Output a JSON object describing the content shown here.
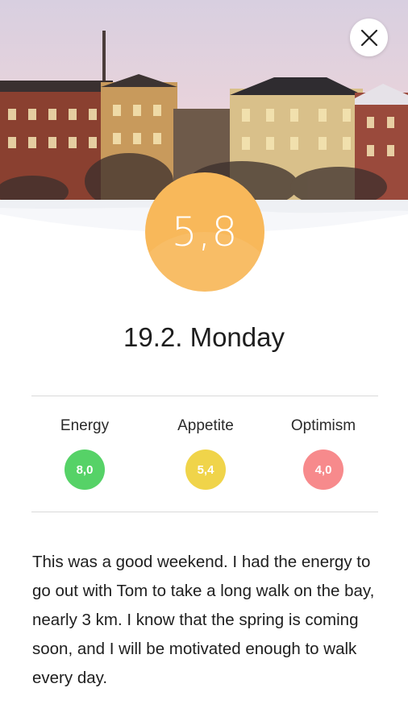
{
  "header": {
    "close_icon": "close-icon",
    "photo": "winter-townhouses-photo"
  },
  "score": {
    "value": "5,8",
    "color": "#F8B85A"
  },
  "entry": {
    "date_title": "19.2. Monday",
    "note": "This was a good weekend. I had the energy to go out with Tom to take a long walk on the bay, nearly 3 km. I know that the spring is coming soon, and I will be motivated enough to walk every day."
  },
  "metrics": [
    {
      "label": "Energy",
      "value": "8,0",
      "color": "#56D267"
    },
    {
      "label": "Appetite",
      "value": "5,4",
      "color": "#F0D44A"
    },
    {
      "label": "Optimism",
      "value": "4,0",
      "color": "#F78A8C"
    }
  ]
}
